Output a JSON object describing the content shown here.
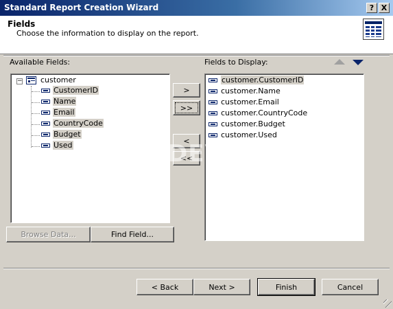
{
  "window": {
    "title": "Standard Report Creation Wizard",
    "help_button": "?",
    "close_button": "X"
  },
  "header": {
    "title": "Fields",
    "subtitle": "Choose the information to display on the report."
  },
  "available": {
    "label": "Available Fields:",
    "table": "customer",
    "fields": [
      "CustomerID",
      "Name",
      "Email",
      "CountryCode",
      "Budget",
      "Used"
    ]
  },
  "display": {
    "label": "Fields to Display:",
    "fields": [
      "customer.CustomerID",
      "customer.Name",
      "customer.Email",
      "customer.CountryCode",
      "customer.Budget",
      "customer.Used"
    ]
  },
  "transfer": {
    "add_one": ">",
    "add_all": ">>",
    "remove_one": "<",
    "remove_all": "<<"
  },
  "actions": {
    "browse": "Browse Data...",
    "find": "Find Field..."
  },
  "footer": {
    "back": "< Back",
    "next": "Next >",
    "finish": "Finish",
    "cancel": "Cancel"
  },
  "watermark": "SHOTDEV.COM",
  "colors": {
    "titlebar_start": "#0a246a",
    "titlebar_end": "#a6caf0",
    "face": "#d4d0c8",
    "arrow_up": "#a0a0a0",
    "arrow_down": "#0a246a"
  }
}
